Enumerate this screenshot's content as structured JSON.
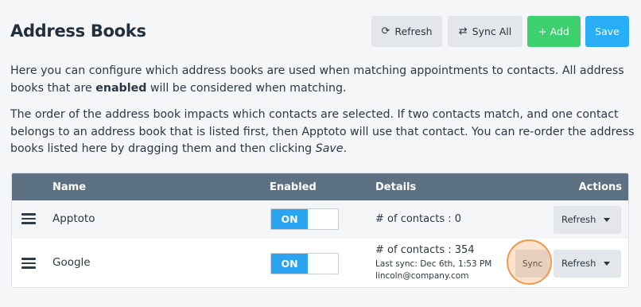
{
  "page": {
    "title": "Address Books"
  },
  "toolbar": {
    "refresh_label": "Refresh",
    "sync_all_label": "Sync All",
    "add_label": "+ Add",
    "save_label": "Save"
  },
  "intro": {
    "p1_before": "Here you can configure which address books are used when matching appointments to contacts. All address books that are ",
    "p1_bold": "enabled",
    "p1_after": " will be considered when matching.",
    "p2_before": "The order of the address book impacts which contacts are selected. If two contacts match, and one contact belongs to an address book that is listed first, then Apptoto will use that contact. You can re-order the address books listed here by dragging them and then clicking ",
    "p2_italic": "Save",
    "p2_after": "."
  },
  "table": {
    "headers": {
      "name": "Name",
      "enabled": "Enabled",
      "details": "Details",
      "actions": "Actions"
    },
    "rows": [
      {
        "name": "Apptoto",
        "enabled_label": "ON",
        "contacts": "# of contacts : 0",
        "refresh_label": "Refresh"
      },
      {
        "name": "Google",
        "enabled_label": "ON",
        "contacts": "# of contacts : 354",
        "last_sync": "Last sync: Dec 6th, 1:53 PM",
        "email": "lincoln@company.com",
        "sync_label": "Sync",
        "refresh_label": "Refresh"
      }
    ]
  },
  "colors": {
    "header_bg": "#5c7283",
    "toggle_on": "#2aa4f0",
    "add_button": "#3ecf6e",
    "save_button": "#29aef6",
    "highlight": "#f1994d"
  },
  "icons": {
    "refresh": "refresh-icon",
    "sync_all": "sync-icon",
    "drag": "drag-handle-icon",
    "dropdown": "caret-down-icon"
  }
}
